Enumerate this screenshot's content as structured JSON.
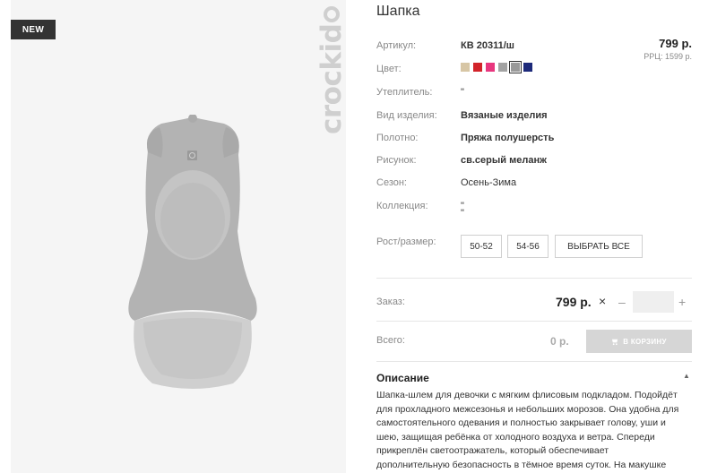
{
  "gallery": {
    "badge": "NEW",
    "brand": "crockid"
  },
  "product": {
    "title": "Шапка",
    "price": "799 р.",
    "rrp": "РРЦ: 1599 р."
  },
  "attributes": {
    "article": {
      "label": "Артикул:",
      "value": "КВ 20311/ш"
    },
    "color": {
      "label": "Цвет:"
    },
    "insulation": {
      "label": "Утеплитель:",
      "value": "\""
    },
    "type": {
      "label": "Вид изделия:",
      "value": "Вязаные изделия"
    },
    "fabric": {
      "label": "Полотно:",
      "value": "Пряжа полушерсть"
    },
    "pattern": {
      "label": "Рисунок:",
      "value": "св.серый меланж"
    },
    "season": {
      "label": "Сезон:",
      "value": "Осень-Зима"
    },
    "collection": {
      "label": "Коллекция:",
      "value": "\"",
      "value2": "\""
    }
  },
  "swatches": [
    "#d7c6a5",
    "#d2232a",
    "#e8367e",
    "#a3a3a3",
    "#9a9a9a",
    "#1d2a7a"
  ],
  "sizes": {
    "label": "Рост/размер:",
    "options": [
      "50-52",
      "54-56"
    ],
    "select_all": "ВЫБРАТЬ ВСЕ"
  },
  "order": {
    "label": "Заказ:",
    "price": "799 р.",
    "times": "×",
    "minus": "–",
    "plus": "+",
    "qty": ""
  },
  "total": {
    "label": "Всего:",
    "value": "0 р.",
    "cart_button": "В КОРЗИНУ"
  },
  "description": {
    "title": "Описание",
    "toggle": "▲",
    "lines": [
      "Шапка-шлем для девочки с мягким флисовым подкладом. Подойдёт",
      "для прохладного межсезонья и небольших морозов. Она удобна для",
      "самостоятельного одевания и полностью закрывает голову, уши и",
      "шею, защищая ребёнка от холодного воздуха и ветра. Спереди",
      "прикреплён светоотражатель, который обеспечивает",
      "дополнительную безопасность в тёмное время суток. На макушке"
    ]
  }
}
